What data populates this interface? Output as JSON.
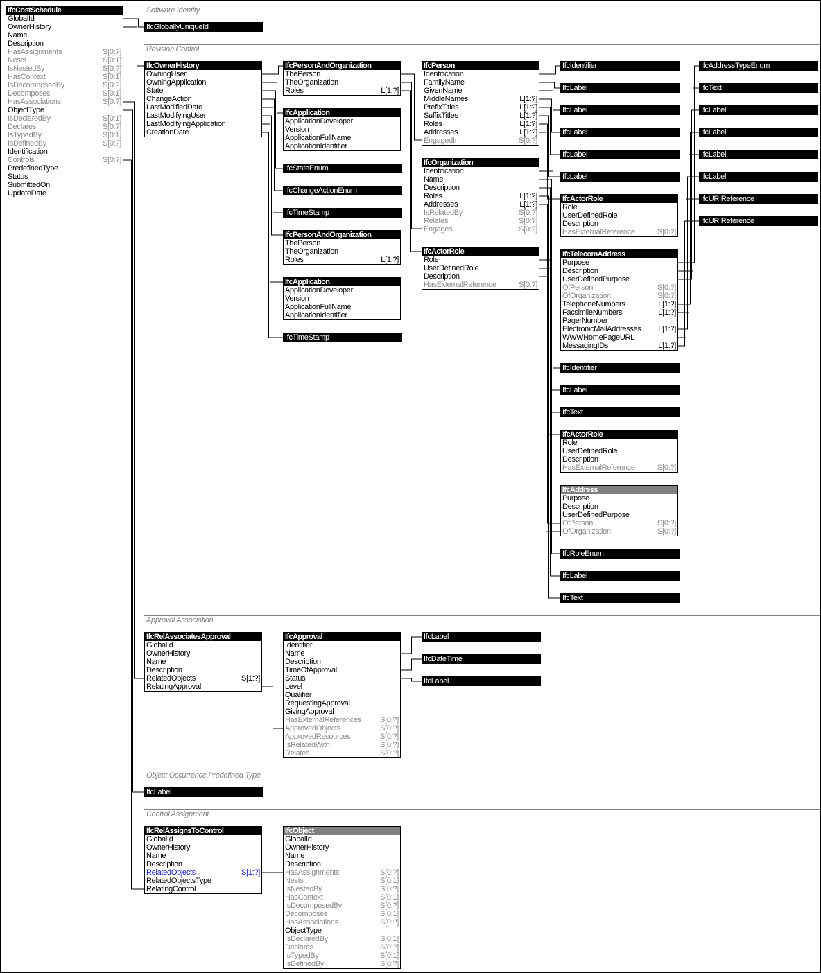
{
  "sections": [
    {
      "title": "Software Identity"
    },
    {
      "title": "Revision Control"
    },
    {
      "title": "Approval Association"
    },
    {
      "title": "Object Occurrence Predefined Type"
    },
    {
      "title": "Control Assignment"
    }
  ],
  "entities": [
    {
      "id": "costschedule",
      "name": "IfcCostSchedule",
      "abstract": false,
      "attrs": [
        {
          "n": "GlobalId"
        },
        {
          "n": "OwnerHistory"
        },
        {
          "n": "Name"
        },
        {
          "n": "Description"
        },
        {
          "n": "HasAssignments",
          "c": "S[0:?]",
          "inv": true
        },
        {
          "n": "Nests",
          "c": "S[0:1]",
          "inv": true
        },
        {
          "n": "IsNestedBy",
          "c": "S[0:?]",
          "inv": true
        },
        {
          "n": "HasContext",
          "c": "S[0:1]",
          "inv": true
        },
        {
          "n": "IsDecomposedBy",
          "c": "S[0:?]",
          "inv": true
        },
        {
          "n": "Decomposes",
          "c": "S[0:1]",
          "inv": true
        },
        {
          "n": "HasAssociations",
          "c": "S[0:?]",
          "inv": true
        },
        {
          "n": "ObjectType"
        },
        {
          "n": "IsDeclaredBy",
          "c": "S[0:1]",
          "inv": true
        },
        {
          "n": "Declares",
          "c": "S[0:?]",
          "inv": true
        },
        {
          "n": "IsTypedBy",
          "c": "S[0:1]",
          "inv": true
        },
        {
          "n": "IsDefinedBy",
          "c": "S[0:?]",
          "inv": true
        },
        {
          "n": "Identification"
        },
        {
          "n": "Controls",
          "c": "S[0:?]",
          "inv": true
        },
        {
          "n": "PredefinedType"
        },
        {
          "n": "Status"
        },
        {
          "n": "SubmittedOn"
        },
        {
          "n": "UpdateDate"
        }
      ]
    },
    {
      "id": "ownerhistory",
      "name": "IfcOwnerHistory",
      "abstract": false,
      "attrs": [
        {
          "n": "OwningUser"
        },
        {
          "n": "OwningApplication"
        },
        {
          "n": "State"
        },
        {
          "n": "ChangeAction"
        },
        {
          "n": "LastModifiedDate"
        },
        {
          "n": "LastModifyingUser"
        },
        {
          "n": "LastModifyingApplication"
        },
        {
          "n": "CreationDate"
        }
      ]
    },
    {
      "id": "pao1",
      "name": "IfcPersonAndOrganization",
      "abstract": false,
      "attrs": [
        {
          "n": "ThePerson"
        },
        {
          "n": "TheOrganization"
        },
        {
          "n": "Roles",
          "c": "L[1:?]"
        }
      ]
    },
    {
      "id": "app1",
      "name": "IfcApplication",
      "abstract": false,
      "attrs": [
        {
          "n": "ApplicationDeveloper"
        },
        {
          "n": "Version"
        },
        {
          "n": "ApplicationFullName"
        },
        {
          "n": "ApplicationIdentifier"
        }
      ]
    },
    {
      "id": "pao2",
      "name": "IfcPersonAndOrganization",
      "abstract": false,
      "attrs": [
        {
          "n": "ThePerson"
        },
        {
          "n": "TheOrganization"
        },
        {
          "n": "Roles",
          "c": "L[1:?]"
        }
      ]
    },
    {
      "id": "app2",
      "name": "IfcApplication",
      "abstract": false,
      "attrs": [
        {
          "n": "ApplicationDeveloper"
        },
        {
          "n": "Version"
        },
        {
          "n": "ApplicationFullName"
        },
        {
          "n": "ApplicationIdentifier"
        }
      ]
    },
    {
      "id": "person",
      "name": "IfcPerson",
      "abstract": false,
      "attrs": [
        {
          "n": "Identification"
        },
        {
          "n": "FamilyName"
        },
        {
          "n": "GivenName"
        },
        {
          "n": "MiddleNames",
          "c": "L[1:?]"
        },
        {
          "n": "PrefixTitles",
          "c": "L[1:?]"
        },
        {
          "n": "SuffixTitles",
          "c": "L[1:?]"
        },
        {
          "n": "Roles",
          "c": "L[1:?]"
        },
        {
          "n": "Addresses",
          "c": "L[1:?]"
        },
        {
          "n": "EngagedIn",
          "c": "S[0:?]",
          "inv": true
        }
      ]
    },
    {
      "id": "org",
      "name": "IfcOrganization",
      "abstract": false,
      "attrs": [
        {
          "n": "Identification"
        },
        {
          "n": "Name"
        },
        {
          "n": "Description"
        },
        {
          "n": "Roles",
          "c": "L[1:?]"
        },
        {
          "n": "Addresses",
          "c": "L[1:?]"
        },
        {
          "n": "IsRelatedBy",
          "c": "S[0:?]",
          "inv": true
        },
        {
          "n": "Relates",
          "c": "S[0:?]",
          "inv": true
        },
        {
          "n": "Engages",
          "c": "S[0:?]",
          "inv": true
        }
      ]
    },
    {
      "id": "actorrole1",
      "name": "IfcActorRole",
      "abstract": false,
      "attrs": [
        {
          "n": "Role"
        },
        {
          "n": "UserDefinedRole"
        },
        {
          "n": "Description"
        },
        {
          "n": "HasExternalReference",
          "c": "S[0:?]",
          "inv": true
        }
      ]
    },
    {
      "id": "actorrole2",
      "name": "IfcActorRole",
      "abstract": false,
      "attrs": [
        {
          "n": "Role"
        },
        {
          "n": "UserDefinedRole"
        },
        {
          "n": "Description"
        },
        {
          "n": "HasExternalReference",
          "c": "S[0:?]",
          "inv": true
        }
      ]
    },
    {
      "id": "telecom",
      "name": "IfcTelecomAddress",
      "abstract": false,
      "attrs": [
        {
          "n": "Purpose"
        },
        {
          "n": "Description"
        },
        {
          "n": "UserDefinedPurpose"
        },
        {
          "n": "OfPerson",
          "c": "S[0:?]",
          "inv": true
        },
        {
          "n": "OfOrganization",
          "c": "S[0:?]",
          "inv": true
        },
        {
          "n": "TelephoneNumbers",
          "c": "L[1:?]"
        },
        {
          "n": "FacsimileNumbers",
          "c": "L[1:?]"
        },
        {
          "n": "PagerNumber"
        },
        {
          "n": "ElectronicMailAddresses",
          "c": "L[1:?]"
        },
        {
          "n": "WWWHomePageURL"
        },
        {
          "n": "MessagingIDs",
          "c": "L[1:?]"
        }
      ]
    },
    {
      "id": "actorrole3",
      "name": "IfcActorRole",
      "abstract": false,
      "attrs": [
        {
          "n": "Role"
        },
        {
          "n": "UserDefinedRole"
        },
        {
          "n": "Description"
        },
        {
          "n": "HasExternalReference",
          "c": "S[0:?]",
          "inv": true
        }
      ]
    },
    {
      "id": "address",
      "name": "IfcAddress",
      "abstract": true,
      "attrs": [
        {
          "n": "Purpose"
        },
        {
          "n": "Description"
        },
        {
          "n": "UserDefinedPurpose"
        },
        {
          "n": "OfPerson",
          "c": "S[0:?]",
          "inv": true
        },
        {
          "n": "OfOrganization",
          "c": "S[0:?]",
          "inv": true
        }
      ]
    },
    {
      "id": "relapproval",
      "name": "IfcRelAssociatesApproval",
      "abstract": false,
      "attrs": [
        {
          "n": "GlobalId"
        },
        {
          "n": "OwnerHistory"
        },
        {
          "n": "Name"
        },
        {
          "n": "Description"
        },
        {
          "n": "RelatedObjects",
          "c": "S[1:?]"
        },
        {
          "n": "RelatingApproval"
        }
      ]
    },
    {
      "id": "approval",
      "name": "IfcApproval",
      "abstract": false,
      "attrs": [
        {
          "n": "Identifier"
        },
        {
          "n": "Name"
        },
        {
          "n": "Description"
        },
        {
          "n": "TimeOfApproval"
        },
        {
          "n": "Status"
        },
        {
          "n": "Level"
        },
        {
          "n": "Qualifier"
        },
        {
          "n": "RequestingApproval"
        },
        {
          "n": "GivingApproval"
        },
        {
          "n": "HasExternalReferences",
          "c": "S[0:?]",
          "inv": true
        },
        {
          "n": "ApprovedObjects",
          "c": "S[0:?]",
          "inv": true
        },
        {
          "n": "ApprovedResources",
          "c": "S[0:?]",
          "inv": true
        },
        {
          "n": "IsRelatedWith",
          "c": "S[0:?]",
          "inv": true
        },
        {
          "n": "Relates",
          "c": "S[0:?]",
          "inv": true
        }
      ]
    },
    {
      "id": "relcontrol",
      "name": "IfcRelAssignsToControl",
      "abstract": false,
      "attrs": [
        {
          "n": "GlobalId"
        },
        {
          "n": "OwnerHistory"
        },
        {
          "n": "Name"
        },
        {
          "n": "Description"
        },
        {
          "n": "RelatedObjects",
          "c": "S[1:?]",
          "hl": true
        },
        {
          "n": "RelatedObjectsType"
        },
        {
          "n": "RelatingControl"
        }
      ]
    },
    {
      "id": "object",
      "name": "IfcObject",
      "abstract": true,
      "attrs": [
        {
          "n": "GlobalId"
        },
        {
          "n": "OwnerHistory"
        },
        {
          "n": "Name"
        },
        {
          "n": "Description"
        },
        {
          "n": "HasAssignments",
          "c": "S[0:?]",
          "inv": true
        },
        {
          "n": "Nests",
          "c": "S[0:1]",
          "inv": true
        },
        {
          "n": "IsNestedBy",
          "c": "S[0:?]",
          "inv": true
        },
        {
          "n": "HasContext",
          "c": "S[0:1]",
          "inv": true
        },
        {
          "n": "IsDecomposedBy",
          "c": "S[0:?]",
          "inv": true
        },
        {
          "n": "Decomposes",
          "c": "S[0:1]",
          "inv": true
        },
        {
          "n": "HasAssociations",
          "c": "S[0:?]",
          "inv": true
        },
        {
          "n": "ObjectType"
        },
        {
          "n": "IsDeclaredBy",
          "c": "S[0:1]",
          "inv": true
        },
        {
          "n": "Declares",
          "c": "S[0:?]",
          "inv": true
        },
        {
          "n": "IsTypedBy",
          "c": "S[0:1]",
          "inv": true
        },
        {
          "n": "IsDefinedBy",
          "c": "S[0:?]",
          "inv": true
        }
      ]
    }
  ],
  "types": [
    {
      "id": "guid",
      "name": "IfcGloballyUniqueId"
    },
    {
      "id": "stateenum",
      "name": "IfcStateEnum"
    },
    {
      "id": "changeenum",
      "name": "IfcChangeActionEnum"
    },
    {
      "id": "ts1",
      "name": "IfcTimeStamp"
    },
    {
      "id": "ts2",
      "name": "IfcTimeStamp"
    },
    {
      "id": "p_ident",
      "name": "IfcIdentifier"
    },
    {
      "id": "p_fam",
      "name": "IfcLabel"
    },
    {
      "id": "p_given",
      "name": "IfcLabel"
    },
    {
      "id": "p_mid",
      "name": "IfcLabel"
    },
    {
      "id": "p_pre",
      "name": "IfcLabel"
    },
    {
      "id": "p_suf",
      "name": "IfcLabel"
    },
    {
      "id": "o_ident",
      "name": "IfcIdentifier"
    },
    {
      "id": "o_name",
      "name": "IfcLabel"
    },
    {
      "id": "o_desc",
      "name": "IfcText"
    },
    {
      "id": "r_enum",
      "name": "IfcRoleEnum"
    },
    {
      "id": "r_label",
      "name": "IfcLabel"
    },
    {
      "id": "r_text",
      "name": "IfcText"
    },
    {
      "id": "t_purpose",
      "name": "IfcAddressTypeEnum"
    },
    {
      "id": "t_desc",
      "name": "IfcText"
    },
    {
      "id": "t_udp",
      "name": "IfcLabel"
    },
    {
      "id": "t_tel",
      "name": "IfcLabel"
    },
    {
      "id": "t_fax",
      "name": "IfcLabel"
    },
    {
      "id": "t_pager",
      "name": "IfcLabel"
    },
    {
      "id": "t_email",
      "name": "IfcURIReference"
    },
    {
      "id": "t_www",
      "name": "IfcURIReference"
    },
    {
      "id": "a_ident",
      "name": "IfcLabel"
    },
    {
      "id": "a_time",
      "name": "IfcDateTime"
    },
    {
      "id": "a_status",
      "name": "IfcLabel"
    },
    {
      "id": "predef",
      "name": "IfcLabel"
    }
  ]
}
